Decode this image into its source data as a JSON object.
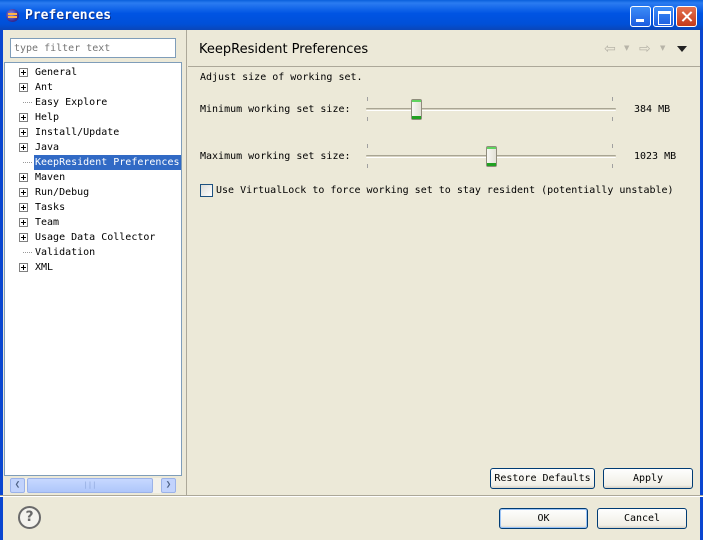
{
  "window": {
    "title": "Preferences",
    "app_icon": "eclipse-icon"
  },
  "sidebar": {
    "filter_placeholder": "type filter text",
    "items": [
      {
        "label": "General",
        "expandable": true
      },
      {
        "label": "Ant",
        "expandable": true
      },
      {
        "label": "Easy Explore",
        "expandable": false
      },
      {
        "label": "Help",
        "expandable": true
      },
      {
        "label": "Install/Update",
        "expandable": true
      },
      {
        "label": "Java",
        "expandable": true
      },
      {
        "label": "KeepResident Preferences",
        "expandable": false,
        "selected": true
      },
      {
        "label": "Maven",
        "expandable": true
      },
      {
        "label": "Run/Debug",
        "expandable": true
      },
      {
        "label": "Tasks",
        "expandable": true
      },
      {
        "label": "Team",
        "expandable": true
      },
      {
        "label": "Usage Data Collector",
        "expandable": true
      },
      {
        "label": "Validation",
        "expandable": false
      },
      {
        "label": "XML",
        "expandable": true
      }
    ]
  },
  "page": {
    "title": "KeepResident Preferences",
    "description": "Adjust size of working set.",
    "min_label": "Minimum working set size:",
    "min_value": "384 MB",
    "min_fraction": 0.2,
    "max_label": "Maximum working set size:",
    "max_value": "1023 MB",
    "max_fraction": 0.5,
    "virtuallock_label": "Use VirtualLock to force working set to stay resident (potentially unstable)",
    "virtuallock_checked": false
  },
  "buttons": {
    "restore_defaults": "Restore Defaults",
    "apply": "Apply",
    "ok": "OK",
    "cancel": "Cancel"
  },
  "colors": {
    "titlebar": "#0054e3",
    "selection": "#316ac5",
    "dialog_bg": "#ece9d8"
  }
}
